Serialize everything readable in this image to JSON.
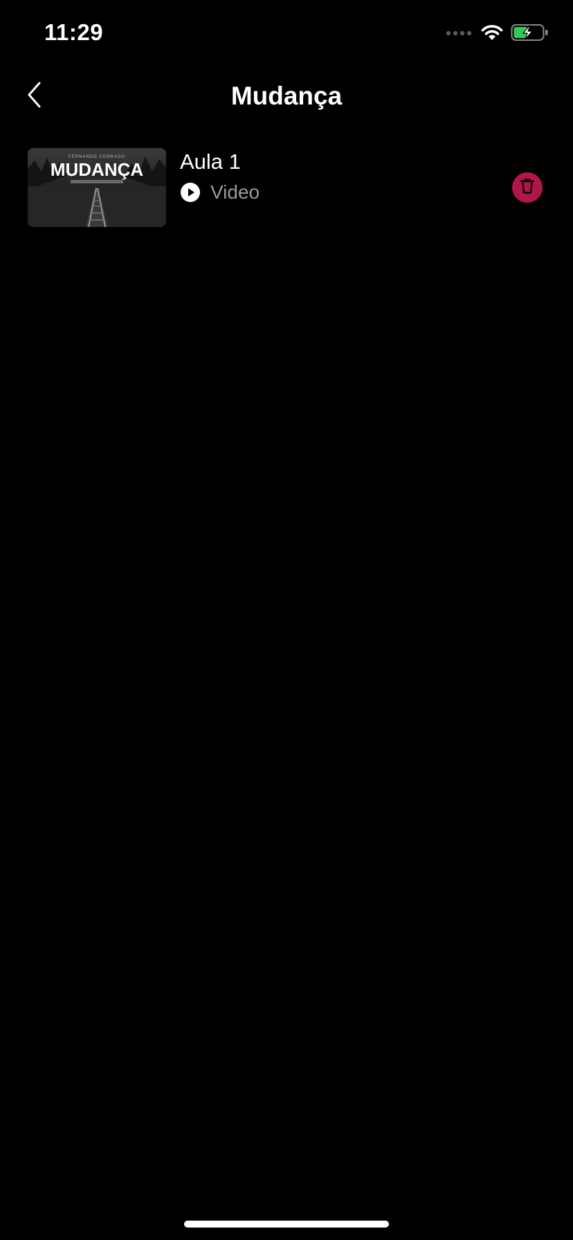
{
  "status_bar": {
    "time": "11:29",
    "icons": [
      "cellular-signal-icon",
      "wifi-icon",
      "battery-charging-icon"
    ]
  },
  "nav": {
    "title": "Mudança",
    "back_icon": "chevron-left-icon"
  },
  "lessons": [
    {
      "title": "Aula 1",
      "type_label": "Video",
      "type_icon": "play-circle-icon",
      "thumbnail": {
        "headline": "MUDANÇA",
        "author": "FERNANDO CONRADO"
      },
      "delete_icon": "trash-icon"
    }
  ],
  "colors": {
    "background": "#000000",
    "delete_accent": "#b0164a",
    "secondary_text": "#9a9a9a",
    "battery_fill": "#34c759"
  }
}
